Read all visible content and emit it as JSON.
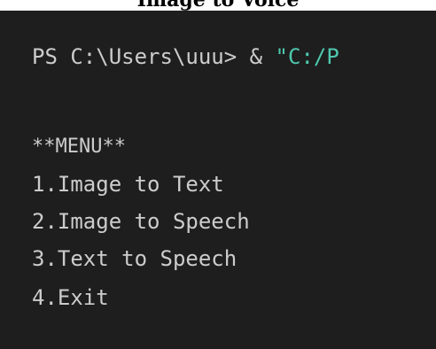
{
  "caption": "Image to Voice",
  "terminal": {
    "prompt": "PS C:\\Users\\uuu> & ",
    "prompt_string": "\"C:/P",
    "menu_title": "**MENU**",
    "menu_items": [
      {
        "label": "1.Image to Text"
      },
      {
        "label": "2.Image to Speech"
      },
      {
        "label": "3.Text to Speech"
      },
      {
        "label": "4.Exit"
      }
    ]
  },
  "colors": {
    "terminal_background": "#1e1e1e",
    "terminal_text": "#cccccc",
    "string_literal": "#4ec9b0"
  }
}
